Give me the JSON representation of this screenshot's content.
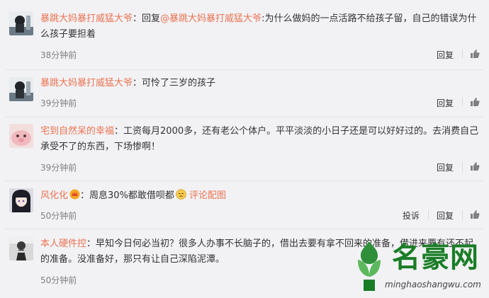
{
  "comments": [
    {
      "username": "暴跳大妈暴打威猛大爷",
      "separator": "：",
      "reply_word": "回复",
      "reply_target": "@暴跳大妈暴打威猛大爷",
      "text": ":为什么做妈的一点活路不给孩子留，自己的错误为什么孩子要担着",
      "time": "38分钟前",
      "reply_label": "回复"
    },
    {
      "username": "暴跳大妈暴打威猛大爷",
      "separator": "：",
      "text": "可怜了三岁的孩子",
      "time": "39分钟前",
      "reply_label": "回复"
    },
    {
      "username": "宅到自然呆的幸福",
      "separator": "：",
      "text": "工资每月2000多，还有老公个体户。平平淡淡的小日子还是可以好好过的。去消费自己承受不了的东西，下场惨啊！",
      "time": "39分钟前",
      "reply_label": "回复"
    },
    {
      "username": "风化化",
      "separator": "：",
      "text": "周息30%都敢借呗都",
      "link": "评论配图",
      "time": "50分钟前",
      "report_label": "投诉",
      "reply_label": "回复"
    },
    {
      "username": "本人硬件控",
      "separator": "：",
      "text": "早知今日何必当初？很多人办事不长脑子的，借出去要有拿不回来的准备，借进来要有还不起的准备。没准备好，那只有让自己深陷泥潭。",
      "time": "50分钟前",
      "reply_label": "回复"
    }
  ],
  "watermark": {
    "title": "名豪网",
    "url": "minghaoshangwu.com"
  },
  "colors": {
    "username": "#eb7350",
    "background": "#f2f2f5",
    "time": "#808080",
    "watermark_green": "#1a7d26"
  },
  "icons": {
    "like": "thumbs-up-icon",
    "emoji_crown": "crown-emoji-icon",
    "emoji_face": "sleepy-face-emoji-icon"
  }
}
